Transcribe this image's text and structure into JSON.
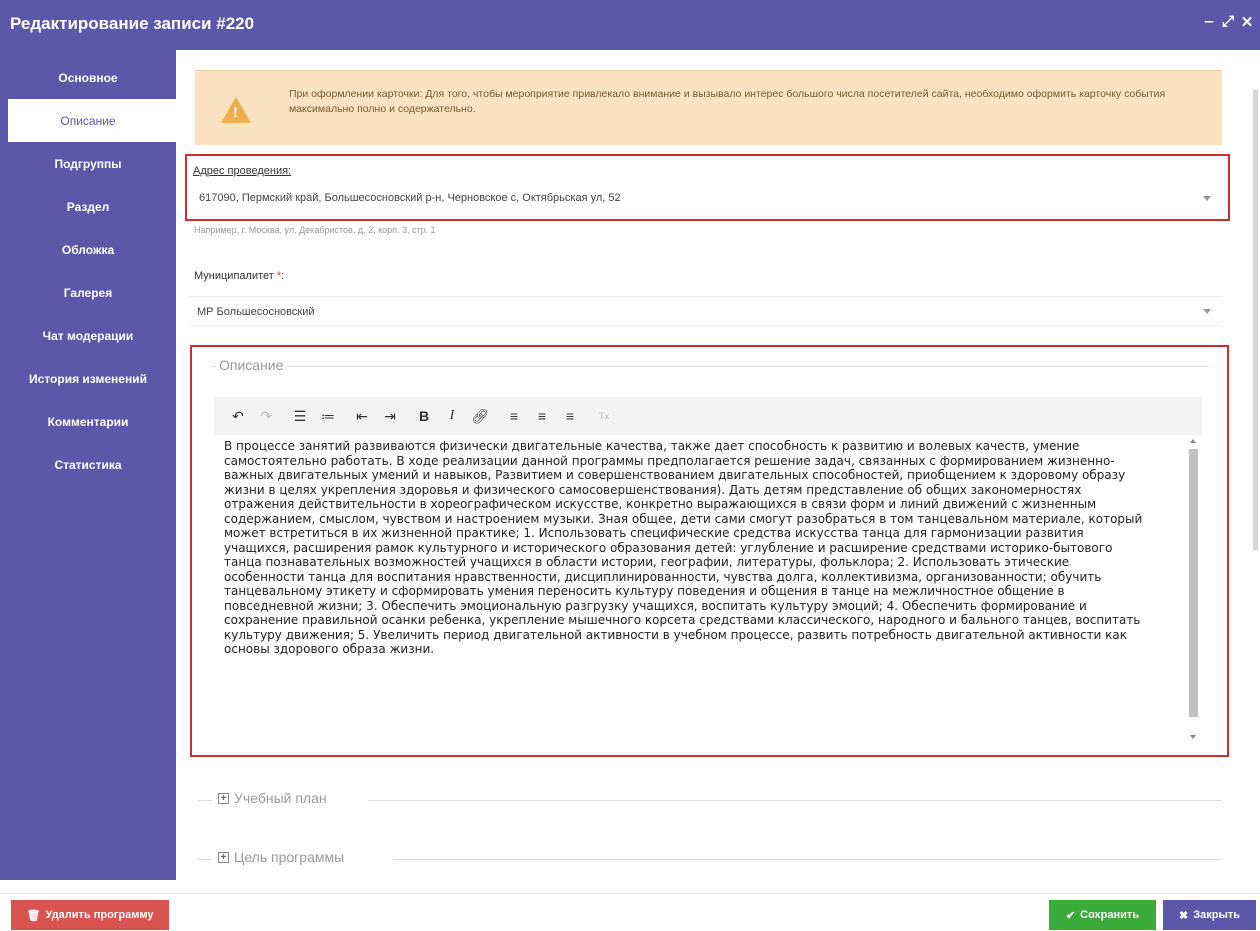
{
  "window": {
    "title": "Редактирование записи #220",
    "controls": [
      "minimize-icon",
      "maximize-icon",
      "close-icon"
    ],
    "accent": "#5c57a8"
  },
  "sidebar": {
    "items": [
      {
        "label": "Основное"
      },
      {
        "label": "Описание"
      },
      {
        "label": "Подгруппы"
      },
      {
        "label": "Раздел"
      },
      {
        "label": "Обложка"
      },
      {
        "label": "Галерея"
      },
      {
        "label": "Чат модерации"
      },
      {
        "label": "История изменений"
      },
      {
        "label": "Комментарии"
      },
      {
        "label": "Статистика"
      }
    ],
    "active": "Описание"
  },
  "alert": {
    "icon": "warning-icon",
    "text": "При оформлении карточки: Для того, чтобы мероприятие привлекало внимание и вызывало интерес большого числа посетителей сайта, необходимо оформить карточку события максимально полно и содержательно."
  },
  "address": {
    "label": "Адрес проведения:",
    "value": "617090, Пермский край, Большесосновский р-н, Черновское с, Октябрьская ул, 52",
    "hint": "Например, г. Москва, ул. Декабристов, д. 2, корп. 3, стр. 1"
  },
  "municipality": {
    "label": "Муниципалитет",
    "required_mark": "*",
    "label_suffix": ":",
    "value": "МР Большесосновский"
  },
  "description": {
    "legend": "Описание",
    "toolbar": [
      "undo-icon",
      "redo-icon",
      "bullet-list-icon",
      "numbered-list-icon",
      "outdent-icon",
      "indent-icon",
      "bold-icon",
      "italic-icon",
      "link-icon",
      "align-left-icon",
      "align-center-icon",
      "align-right-icon",
      "clear-format-icon"
    ],
    "text": "В процессе занятий развиваются физически двигательные качества, также дает способность к развитию и волевых качеств, умение самостоятельно работать. В ходе реализации данной программы предполагается решение задач, связанных с формированием жизненно-важных двигательных умений и навыков, Развитием и совершенствованием двигательных способностей, приобщением к здоровому образу жизни в целях укрепления здоровья и физического самосовершенствования). Дать детям представление об общих закономерностях отражения действительности в хореографическом искусстве, конкретно выражающихся в связи форм и линий движений с жизненным содержанием, смыслом, чувством и настроением музыки. Зная общее, дети сами смогут разобраться в том танцевальном материале, который может встретиться в их жизненной практике; 1. Использовать специфические средства искусства танца для гармонизации развития учащихся, расширения рамок культурного и исторического образования детей: углубление и расширение средствами историко-бытового танца познавательных возможностей учащихся в области истории, географии, литературы, фольклора; 2. Использовать этические особенности танца для воспитания нравственности, дисциплинированности, чувства долга, коллективизма, организованности; обучить танцевальному этикету и сформировать умения переносить культуру поведения и общения в танце на межличностное общение в повседневной жизни; 3. Обеспечить эмоциональную разгрузку учащихся, воспитать культуру эмоций; 4. Обеспечить формирование и сохранение правильной осанки ребенка, укрепление мышечного корсета средствами классического, народного и бального танцев, воспитать культуру движения; 5. Увеличить период двигательной активности в учебном процессе, развить потребность двигательной активности как основы здорового образа жизни."
  },
  "sections": [
    {
      "legend": "Учебный план"
    },
    {
      "legend": "Цель программы"
    }
  ],
  "footer": {
    "delete_label": "Удалить программу",
    "save_label": "Сохранить",
    "close_label": "Закрыть",
    "colors": {
      "delete": "#d9534f",
      "save": "#3cab3c",
      "close": "#5c57a8"
    }
  }
}
